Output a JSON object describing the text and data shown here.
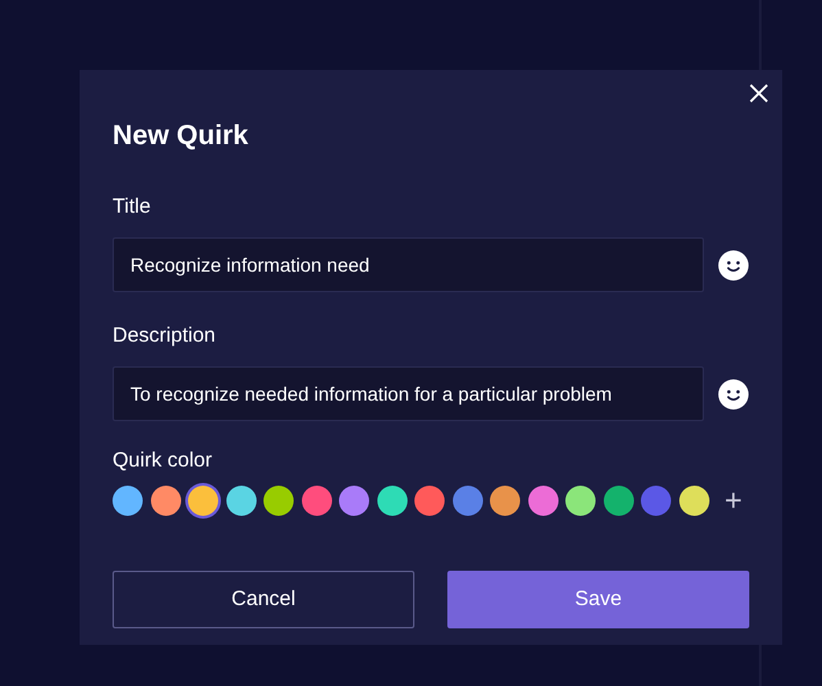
{
  "dialog": {
    "title": "New Quirk",
    "fields": [
      {
        "label": "Title",
        "value": "Recognize information need"
      },
      {
        "label": "Description",
        "value": "To recognize needed information for a particular problem"
      }
    ],
    "color_label": "Quirk color",
    "colors": [
      {
        "color": "#62b6ff",
        "selected": false
      },
      {
        "color": "#ff8a65",
        "selected": false
      },
      {
        "color": "#fbbf3c",
        "selected": true
      },
      {
        "color": "#5ad4e3",
        "selected": false
      },
      {
        "color": "#98cc00",
        "selected": false
      },
      {
        "color": "#ff4d7d",
        "selected": false
      },
      {
        "color": "#a97bf9",
        "selected": false
      },
      {
        "color": "#2edbb5",
        "selected": false
      },
      {
        "color": "#ff5a5a",
        "selected": false
      },
      {
        "color": "#5a80e6",
        "selected": false
      },
      {
        "color": "#e8924a",
        "selected": false
      },
      {
        "color": "#ec6cd6",
        "selected": false
      },
      {
        "color": "#8be57a",
        "selected": false
      },
      {
        "color": "#14b26c",
        "selected": false
      },
      {
        "color": "#5b58e6",
        "selected": false
      },
      {
        "color": "#dede5a",
        "selected": false
      }
    ],
    "add_color": "+",
    "buttons": [
      {
        "kind": "secondary",
        "label": "Cancel"
      },
      {
        "kind": "primary",
        "label": "Save"
      }
    ]
  }
}
